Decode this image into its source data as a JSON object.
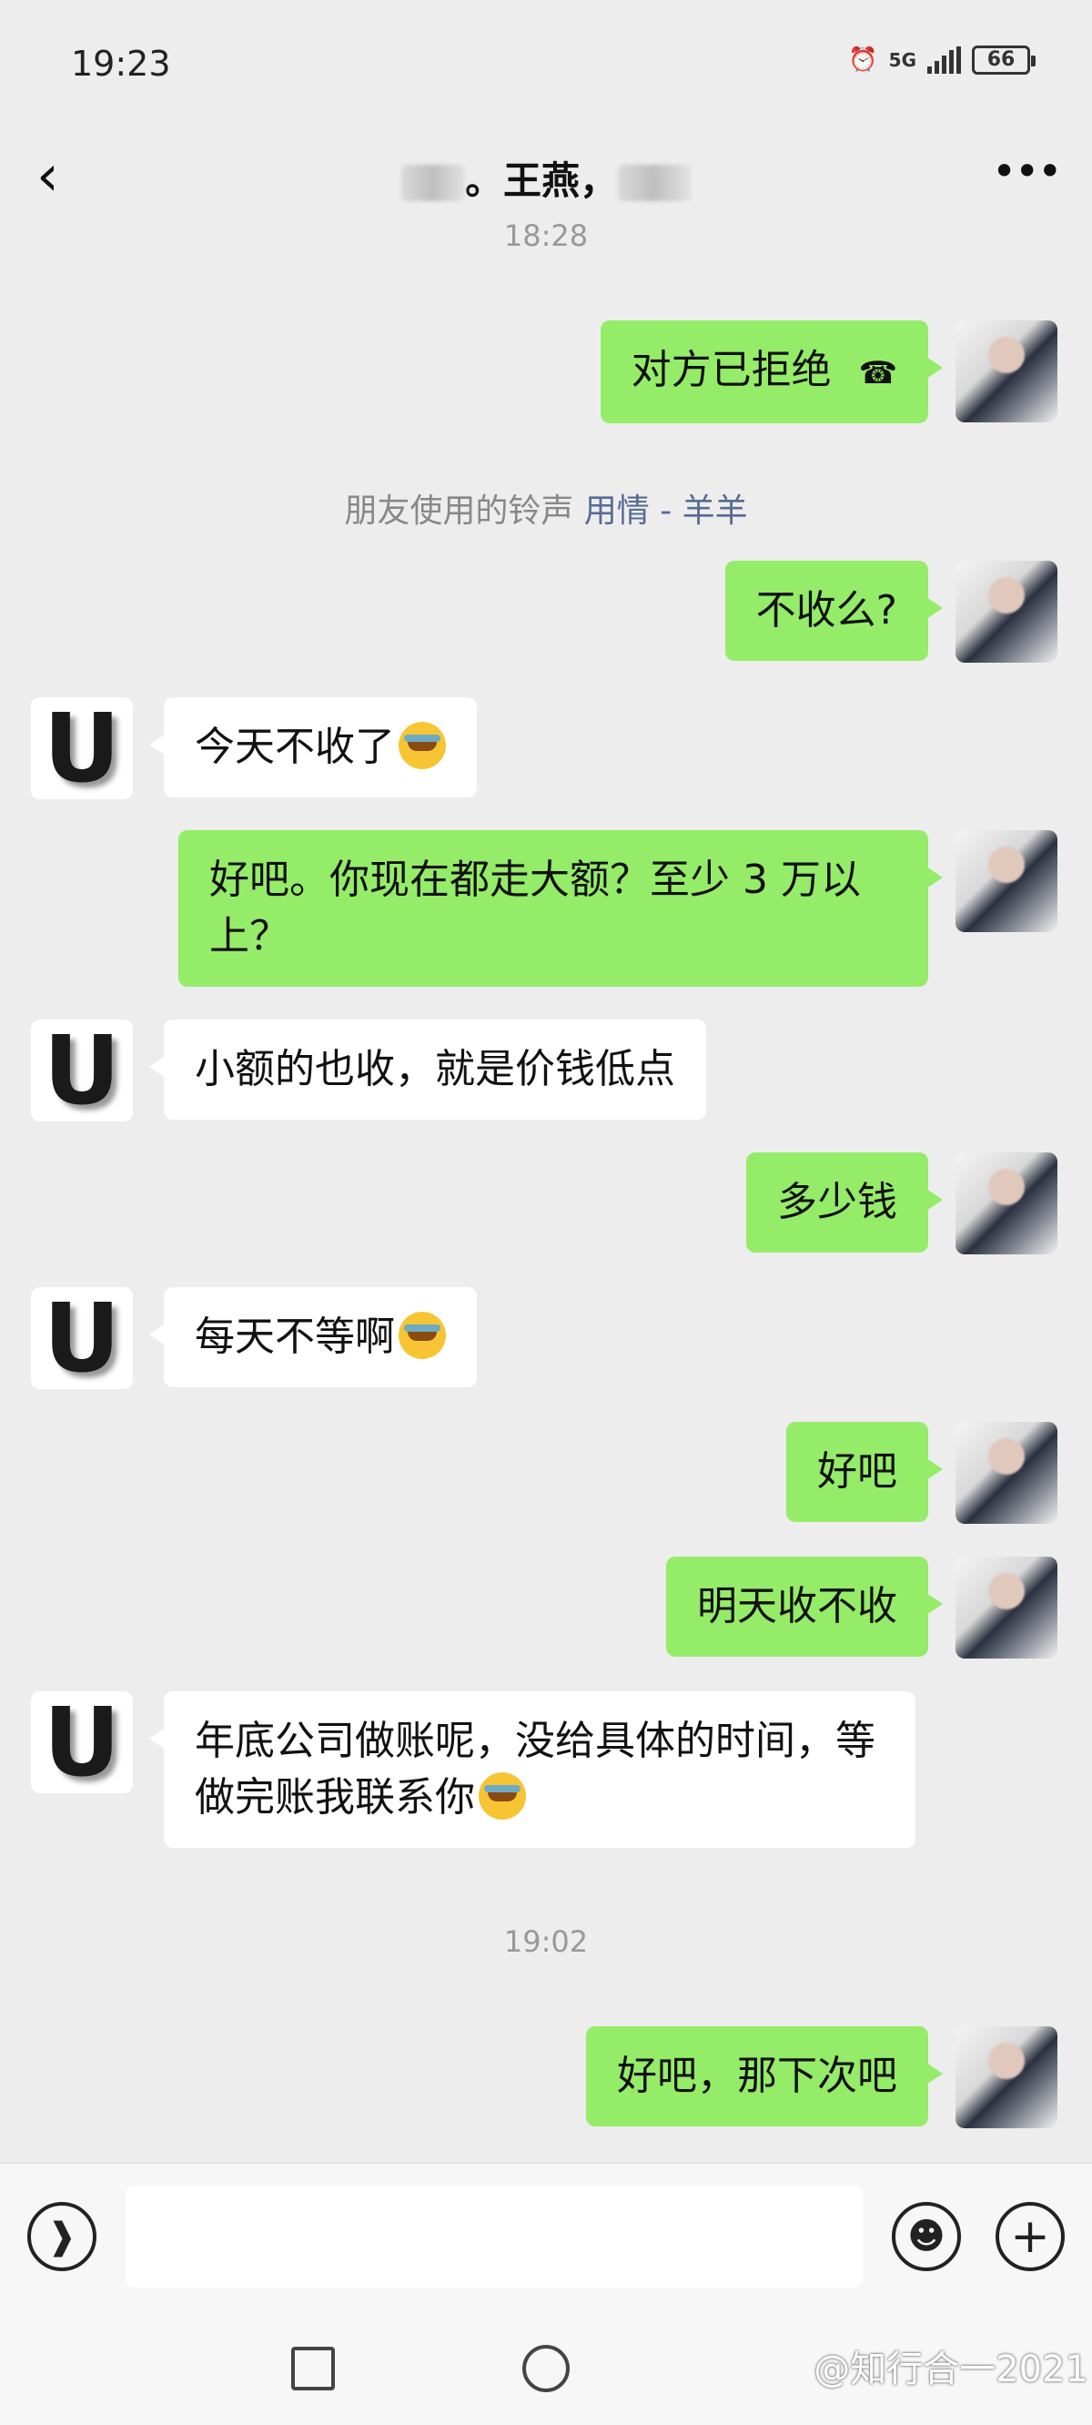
{
  "status_bar": {
    "time": "19:23",
    "network": "5G",
    "battery": "66"
  },
  "header": {
    "title_visible": "。王燕，"
  },
  "timestamps": [
    "18:28",
    "19:02"
  ],
  "system_message": {
    "prefix": "朋友使用的铃声",
    "song": "用情 - 羊羊"
  },
  "messages": [
    {
      "from": "me",
      "text": "对方已拒绝"
    },
    {
      "from": "me",
      "text": "不收么?"
    },
    {
      "from": "other",
      "text": "今天不收了"
    },
    {
      "from": "me",
      "text": "好吧。你现在都走大额？至少 3 万以上？"
    },
    {
      "from": "other",
      "text": "小额的也收，就是价钱低点"
    },
    {
      "from": "me",
      "text": "多少钱"
    },
    {
      "from": "other",
      "text": "每天不等啊"
    },
    {
      "from": "me",
      "text": "好吧"
    },
    {
      "from": "me",
      "text": "明天收不收"
    },
    {
      "from": "other",
      "text": "年底公司做账呢，没给具体的时间，等做完账我联系你"
    },
    {
      "from": "me",
      "text": "好吧，那下次吧"
    }
  ],
  "other_avatar_letter": "U",
  "watermark": "@知行合一2021",
  "icons": {
    "back": "back-chevron-icon",
    "more": "more-dots-icon",
    "voice": "voice-icon",
    "emoji": "emoji-icon",
    "plus": "plus-icon",
    "hangup": "phone-hangup-icon"
  }
}
